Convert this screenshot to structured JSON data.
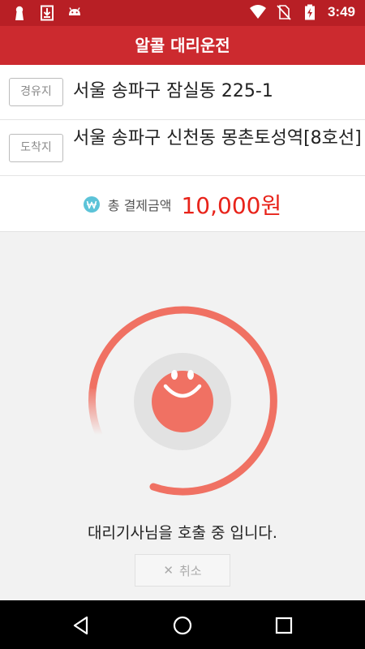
{
  "status_bar": {
    "time": "3:49",
    "left_icons": [
      "keyhole-icon",
      "download-icon",
      "android-icon"
    ],
    "right_icons": [
      "wifi-icon",
      "no-sim-icon",
      "battery-charging-icon"
    ]
  },
  "app_bar": {
    "title": "알콜 대리운전",
    "color": "#cc2a2f"
  },
  "route": {
    "via_label": "경유지",
    "via_address": "서울 송파구 잠실동 225-1",
    "dest_label": "도착지",
    "dest_address": "서울 송파구 신천동 몽촌토성역[8호선]"
  },
  "payment": {
    "icon": "won-icon",
    "label": "총 결제금액",
    "amount": "10,000원",
    "amount_color": "#e8231a"
  },
  "calling": {
    "status_text": "대리기사님을 호출 중 입니다.",
    "cancel_icon": "close-icon",
    "cancel_label": "취소",
    "accent_color": "#f07163"
  },
  "nav_bar": {
    "buttons": [
      "back-icon",
      "home-icon",
      "recents-icon"
    ]
  }
}
